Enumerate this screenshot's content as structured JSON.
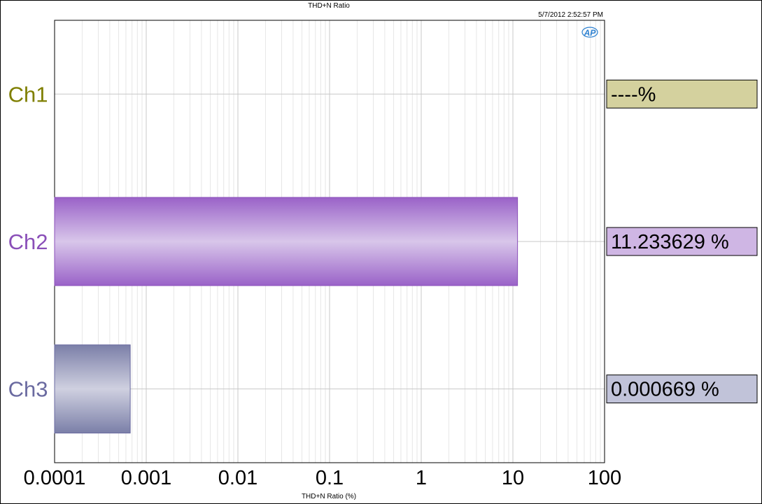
{
  "chart_data": {
    "type": "bar",
    "orientation": "horizontal",
    "title": "THD+N Ratio",
    "timestamp": "5/7/2012 2:52:57 PM",
    "logo": "AP",
    "xlabel": "THD+N Ratio (%)",
    "xscale": "log",
    "xlim": [
      0.0001,
      100
    ],
    "xticks": [
      "0.0001",
      "0.001",
      "0.01",
      "0.1",
      "1",
      "10",
      "100"
    ],
    "grid": true,
    "categories": [
      "Ch1",
      "Ch2",
      "Ch3"
    ],
    "values": [
      null,
      11.233629,
      0.000669
    ],
    "readouts": [
      "----%",
      "11.233629 %",
      "0.000669 %"
    ],
    "colors": {
      "ch1_label": "#7f7f00",
      "ch2_label": "#8a4fb8",
      "ch3_label": "#6a6aa0",
      "ch1_box": "#d4d19e",
      "ch2_box": "#cfb6e4",
      "ch3_box": "#c1c3d9",
      "ch2_bar_edge": "#9a62c8",
      "ch2_bar_mid": "#d8c6ea",
      "ch3_bar_edge": "#7b7fa8",
      "ch3_bar_mid": "#cfd0e0",
      "grid_major": "#c8c8c8",
      "grid_minor": "#e6e6e6",
      "logo": "#2a7fd0"
    }
  }
}
